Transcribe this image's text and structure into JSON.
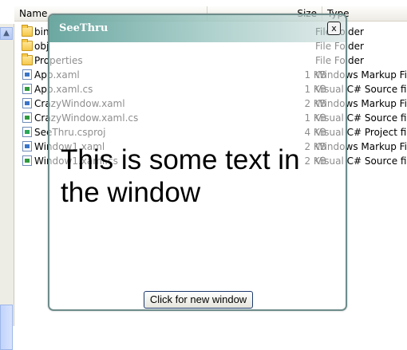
{
  "explorer": {
    "columns": {
      "name": "Name",
      "size": "Size",
      "type": "Type"
    },
    "files": [
      {
        "name": "bin",
        "size": "",
        "type": "File Folder",
        "icon": "folder-icon"
      },
      {
        "name": "obj",
        "size": "",
        "type": "File Folder",
        "icon": "folder-icon"
      },
      {
        "name": "Properties",
        "size": "",
        "type": "File Folder",
        "icon": "folder-icon"
      },
      {
        "name": "App.xaml",
        "size": "1 KB",
        "type": "Windows Markup File",
        "icon": "xaml-file-icon"
      },
      {
        "name": "App.xaml.cs",
        "size": "1 KB",
        "type": "Visual C# Source file",
        "icon": "cs-file-icon"
      },
      {
        "name": "CrazyWindow.xaml",
        "size": "2 KB",
        "type": "Windows Markup File",
        "icon": "xaml-file-icon"
      },
      {
        "name": "CrazyWindow.xaml.cs",
        "size": "1 KB",
        "type": "Visual C# Source file",
        "icon": "cs-file-icon"
      },
      {
        "name": "SeeThru.csproj",
        "size": "4 KB",
        "type": "Visual C# Project file",
        "icon": "csproj-file-icon"
      },
      {
        "name": "Window1.xaml",
        "size": "2 KB",
        "type": "Windows Markup File",
        "icon": "xaml-file-icon"
      },
      {
        "name": "Window1.xaml.cs",
        "size": "2 KB",
        "type": "Visual C# Source file",
        "icon": "cs-file-icon"
      }
    ]
  },
  "window": {
    "title": "SeeThru",
    "close_label": "x",
    "body_text": "This is some text in the window",
    "button_label": "Click for new window"
  },
  "colors": {
    "titlebar": "#5fa099",
    "border": "#6d8c8a",
    "folder": "#f5c84a"
  }
}
